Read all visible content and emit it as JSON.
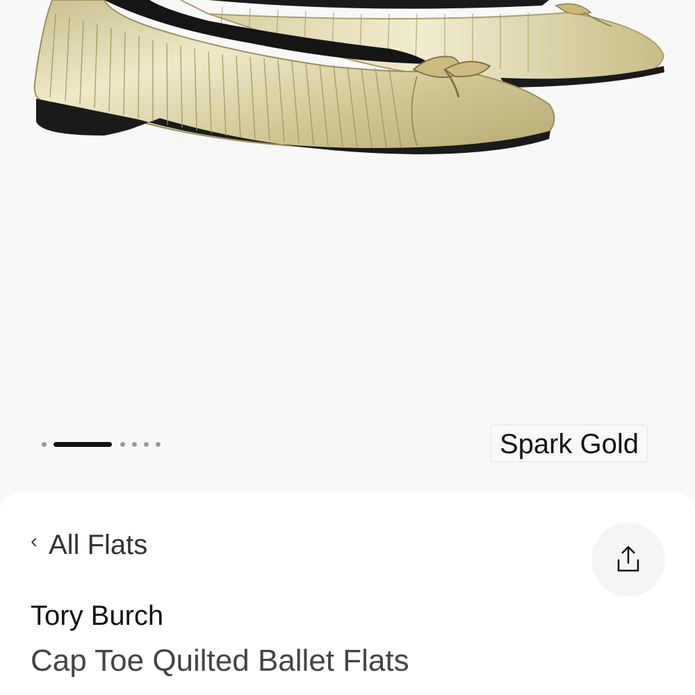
{
  "gallery": {
    "image_alt": "gold-ballet-flats-photo",
    "pager": {
      "total": 6,
      "active_index": 1
    },
    "color_name": "Spark Gold"
  },
  "nav": {
    "back_label": "All Flats",
    "back_icon": "chevron-left-icon",
    "share_icon": "share-icon"
  },
  "product": {
    "brand": "Tory Burch",
    "name": "Cap Toe Quilted Ballet Flats"
  },
  "colors": {
    "background": "#f8f8f8",
    "sheet": "#ffffff",
    "metallic_gold": "#d8cfa2",
    "text_primary": "#111111",
    "text_secondary": "#444444"
  }
}
